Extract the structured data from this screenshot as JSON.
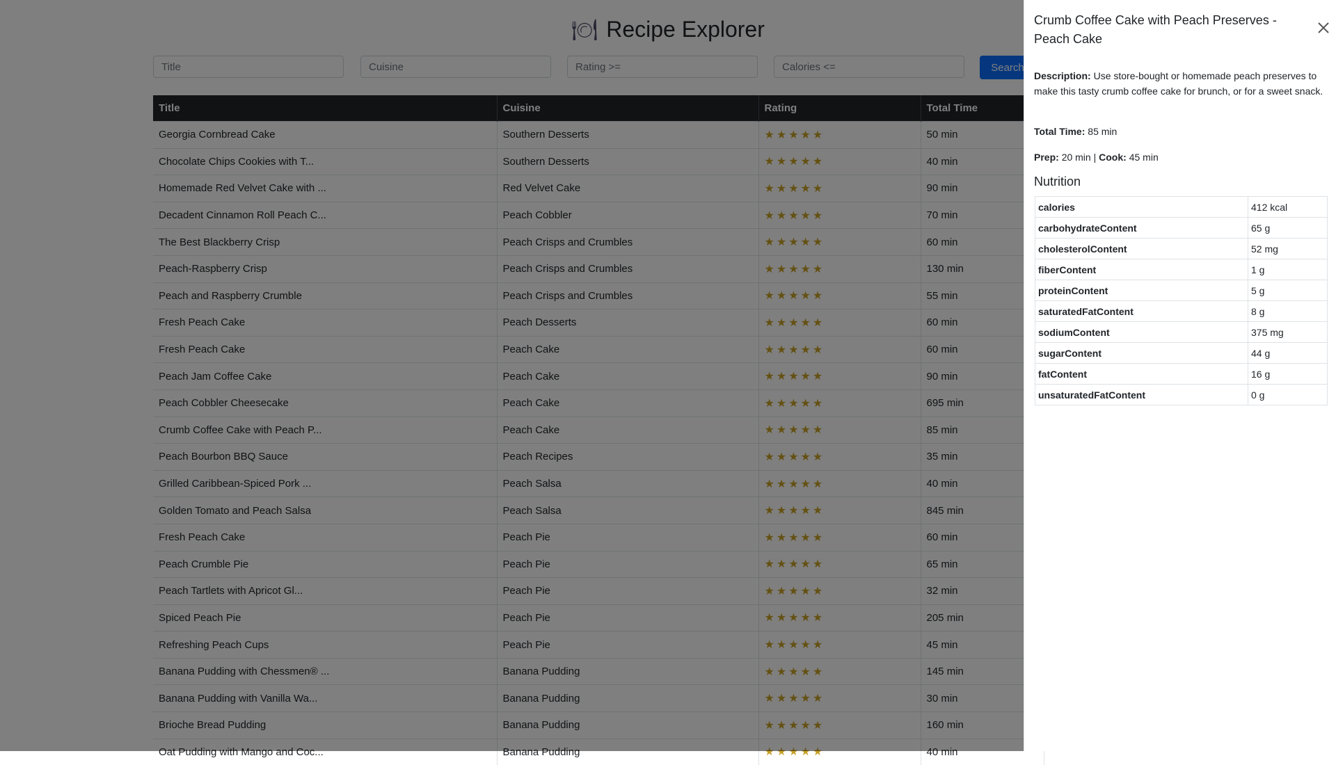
{
  "app": {
    "title": "Recipe Explorer",
    "icon": "plate-fork-knife-icon"
  },
  "filters": {
    "title_placeholder": "Title",
    "cuisine_placeholder": "Cuisine",
    "rating_placeholder": "Rating >=",
    "calories_placeholder": "Calories <=",
    "search_label": "Search"
  },
  "table": {
    "headers": [
      "Title",
      "Cuisine",
      "Rating",
      "Total Time"
    ],
    "rows": [
      {
        "title": "Georgia Cornbread Cake",
        "cuisine": "Southern Desserts",
        "rating": 5,
        "total_time": "50 min"
      },
      {
        "title": "Chocolate Chips Cookies with T...",
        "cuisine": "Southern Desserts",
        "rating": 5,
        "total_time": "40 min"
      },
      {
        "title": "Homemade Red Velvet Cake with ...",
        "cuisine": "Red Velvet Cake",
        "rating": 5,
        "total_time": "90 min"
      },
      {
        "title": "Decadent Cinnamon Roll Peach C...",
        "cuisine": "Peach Cobbler",
        "rating": 5,
        "total_time": "70 min"
      },
      {
        "title": "The Best Blackberry Crisp",
        "cuisine": "Peach Crisps and Crumbles",
        "rating": 5,
        "total_time": "60 min"
      },
      {
        "title": "Peach-Raspberry Crisp",
        "cuisine": "Peach Crisps and Crumbles",
        "rating": 5,
        "total_time": "130 min"
      },
      {
        "title": "Peach and Raspberry Crumble",
        "cuisine": "Peach Crisps and Crumbles",
        "rating": 5,
        "total_time": "55 min"
      },
      {
        "title": "Fresh Peach Cake",
        "cuisine": "Peach Desserts",
        "rating": 5,
        "total_time": "60 min"
      },
      {
        "title": "Fresh Peach Cake",
        "cuisine": "Peach Cake",
        "rating": 5,
        "total_time": "60 min"
      },
      {
        "title": "Peach Jam Coffee Cake",
        "cuisine": "Peach Cake",
        "rating": 5,
        "total_time": "90 min"
      },
      {
        "title": "Peach Cobbler Cheesecake",
        "cuisine": "Peach Cake",
        "rating": 5,
        "total_time": "695 min"
      },
      {
        "title": "Crumb Coffee Cake with Peach P...",
        "cuisine": "Peach Cake",
        "rating": 5,
        "total_time": "85 min"
      },
      {
        "title": "Peach Bourbon BBQ Sauce",
        "cuisine": "Peach Recipes",
        "rating": 5,
        "total_time": "35 min"
      },
      {
        "title": "Grilled Caribbean-Spiced Pork ...",
        "cuisine": "Peach Salsa",
        "rating": 5,
        "total_time": "40 min"
      },
      {
        "title": "Golden Tomato and Peach Salsa",
        "cuisine": "Peach Salsa",
        "rating": 5,
        "total_time": "845 min"
      },
      {
        "title": "Fresh Peach Cake",
        "cuisine": "Peach Pie",
        "rating": 5,
        "total_time": "60 min"
      },
      {
        "title": "Peach Crumble Pie",
        "cuisine": "Peach Pie",
        "rating": 5,
        "total_time": "65 min"
      },
      {
        "title": "Peach Tartlets with Apricot Gl...",
        "cuisine": "Peach Pie",
        "rating": 5,
        "total_time": "32 min"
      },
      {
        "title": "Spiced Peach Pie",
        "cuisine": "Peach Pie",
        "rating": 5,
        "total_time": "205 min"
      },
      {
        "title": "Refreshing Peach Cups",
        "cuisine": "Peach Pie",
        "rating": 5,
        "total_time": "45 min"
      },
      {
        "title": "Banana Pudding with Chessmen® ...",
        "cuisine": "Banana Pudding",
        "rating": 5,
        "total_time": "145 min"
      },
      {
        "title": "Banana Pudding with Vanilla Wa...",
        "cuisine": "Banana Pudding",
        "rating": 5,
        "total_time": "30 min"
      },
      {
        "title": "Brioche Bread Pudding",
        "cuisine": "Banana Pudding",
        "rating": 5,
        "total_time": "160 min"
      },
      {
        "title": "Oat Pudding with Mango and Coc...",
        "cuisine": "Banana Pudding",
        "rating": 5,
        "total_time": "40 min"
      }
    ]
  },
  "detail": {
    "title": "Crumb Coffee Cake with Peach Preserves - Peach Cake",
    "close_icon": "close-icon",
    "description_label": "Description:",
    "description": "Use store-bought or homemade peach preserves to make this tasty crumb coffee cake for brunch, or for a sweet snack.",
    "total_time_label": "Total Time:",
    "total_time": "85 min",
    "prep_label": "Prep:",
    "prep": "20 min",
    "separator": "|",
    "cook_label": "Cook:",
    "cook": "45 min",
    "nutrition_heading": "Nutrition",
    "nutrition": [
      {
        "key": "calories",
        "value": "412 kcal"
      },
      {
        "key": "carbohydrateContent",
        "value": "65 g"
      },
      {
        "key": "cholesterolContent",
        "value": "52 mg"
      },
      {
        "key": "fiberContent",
        "value": "1 g"
      },
      {
        "key": "proteinContent",
        "value": "5 g"
      },
      {
        "key": "saturatedFatContent",
        "value": "8 g"
      },
      {
        "key": "sodiumContent",
        "value": "375 mg"
      },
      {
        "key": "sugarContent",
        "value": "44 g"
      },
      {
        "key": "fatContent",
        "value": "16 g"
      },
      {
        "key": "unsaturatedFatContent",
        "value": "0 g"
      }
    ]
  },
  "colors": {
    "overlay": "#000000",
    "table_header_bg": "#212529",
    "primary_button": "#0d6efd",
    "star": "#c9a227"
  }
}
